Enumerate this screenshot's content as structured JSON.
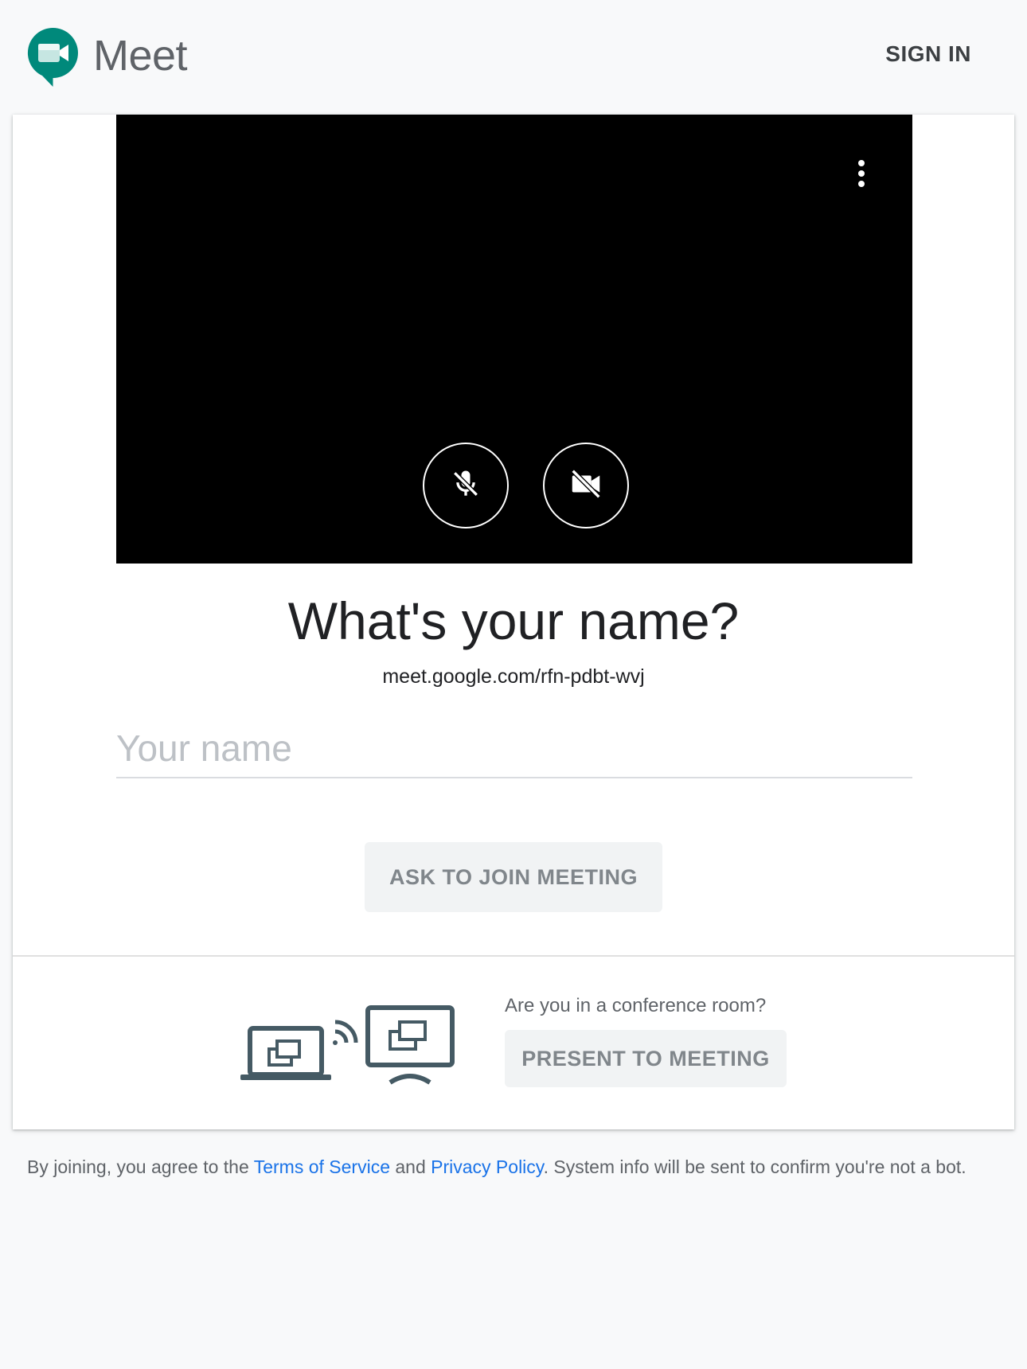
{
  "header": {
    "brand": "Meet",
    "sign_in": "SIGN IN"
  },
  "preview": {
    "mic_state": "muted",
    "camera_state": "off"
  },
  "join": {
    "title": "What's your name?",
    "meeting_url": "meet.google.com/rfn-pdbt-wvj",
    "name_placeholder": "Your name",
    "name_value": "",
    "ask_button": "ASK TO JOIN MEETING"
  },
  "conference": {
    "question": "Are you in a conference room?",
    "present_button": "PRESENT TO MEETING"
  },
  "footer": {
    "prefix": "By joining, you agree to the ",
    "terms": "Terms of Service",
    "and": " and ",
    "privacy": "Privacy Policy",
    "suffix": ". System info will be sent to confirm you're not a bot."
  },
  "colors": {
    "logo": "#00897b",
    "link": "#1a73e8",
    "device_icon": "#455a64"
  }
}
